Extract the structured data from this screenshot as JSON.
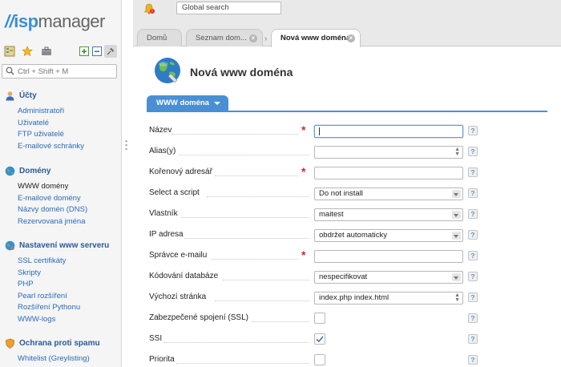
{
  "app": {
    "logo_text": "ispmanager",
    "logo_isp": "isp",
    "logo_mgr": "manager"
  },
  "sidebar": {
    "search_placeholder": "Ctrl + Shift + M",
    "sections": [
      {
        "title": "Účty",
        "icon": "user-icon",
        "items": [
          "Administratoři",
          "Uživatelé",
          "FTP uživatelé",
          "E-mailové schránky"
        ]
      },
      {
        "title": "Domény",
        "icon": "globe-icon",
        "items": [
          "WWW domény",
          "E-mailové domény",
          "Názvy domén (DNS)",
          "Rezervovaná jména"
        ],
        "active_index": 0
      },
      {
        "title": "Nastavení www serveru",
        "icon": "gear-globe-icon",
        "items": [
          "SSL certifikáty",
          "Skripty",
          "PHP",
          "Pearl rozšíření",
          "Rozšíření Pythonu",
          "WWW-logs"
        ]
      },
      {
        "title": "Ochrana proti spamu",
        "icon": "shield-icon",
        "items": [
          "Whitelist (Greylisting)"
        ]
      }
    ]
  },
  "topbar": {
    "search_placeholder": "Global search"
  },
  "tabs": [
    {
      "label": "Domů"
    },
    {
      "label": "Seznam dom..."
    },
    {
      "label": "Nová www doména"
    }
  ],
  "page": {
    "title": "Nová www doména",
    "form_tab": "WWW doména",
    "fields": [
      {
        "label": "Název",
        "type": "text",
        "required": true,
        "value": ""
      },
      {
        "label": "Alias(y)",
        "type": "text-spin",
        "required": false,
        "value": ""
      },
      {
        "label": "Kořenový adresář",
        "type": "text",
        "required": true,
        "value": ""
      },
      {
        "label": "Select a script",
        "type": "select",
        "required": false,
        "value": "Do not install"
      },
      {
        "label": "Vlastník",
        "type": "select",
        "required": false,
        "value": "maitest"
      },
      {
        "label": "IP adresa",
        "type": "select",
        "required": false,
        "value": "obdržet automaticky"
      },
      {
        "label": "Správce e-mailu",
        "type": "text",
        "required": true,
        "value": ""
      },
      {
        "label": "Kódování databáze",
        "type": "select",
        "required": false,
        "value": "nespecifikovat"
      },
      {
        "label": "Výchozí stránka",
        "type": "text-spin",
        "required": false,
        "value": "index.php index.html"
      },
      {
        "label": "Zabezpečené spojení (SSL)",
        "type": "checkbox",
        "required": false,
        "checked": false
      },
      {
        "label": "SSI",
        "type": "checkbox",
        "required": false,
        "checked": true
      },
      {
        "label": "Priorita",
        "type": "checkbox",
        "required": false,
        "checked": false
      }
    ],
    "help_symbol": "?"
  },
  "colors": {
    "accent": "#4a8fd3",
    "link": "#2a6abb",
    "required": "#e0242a"
  }
}
